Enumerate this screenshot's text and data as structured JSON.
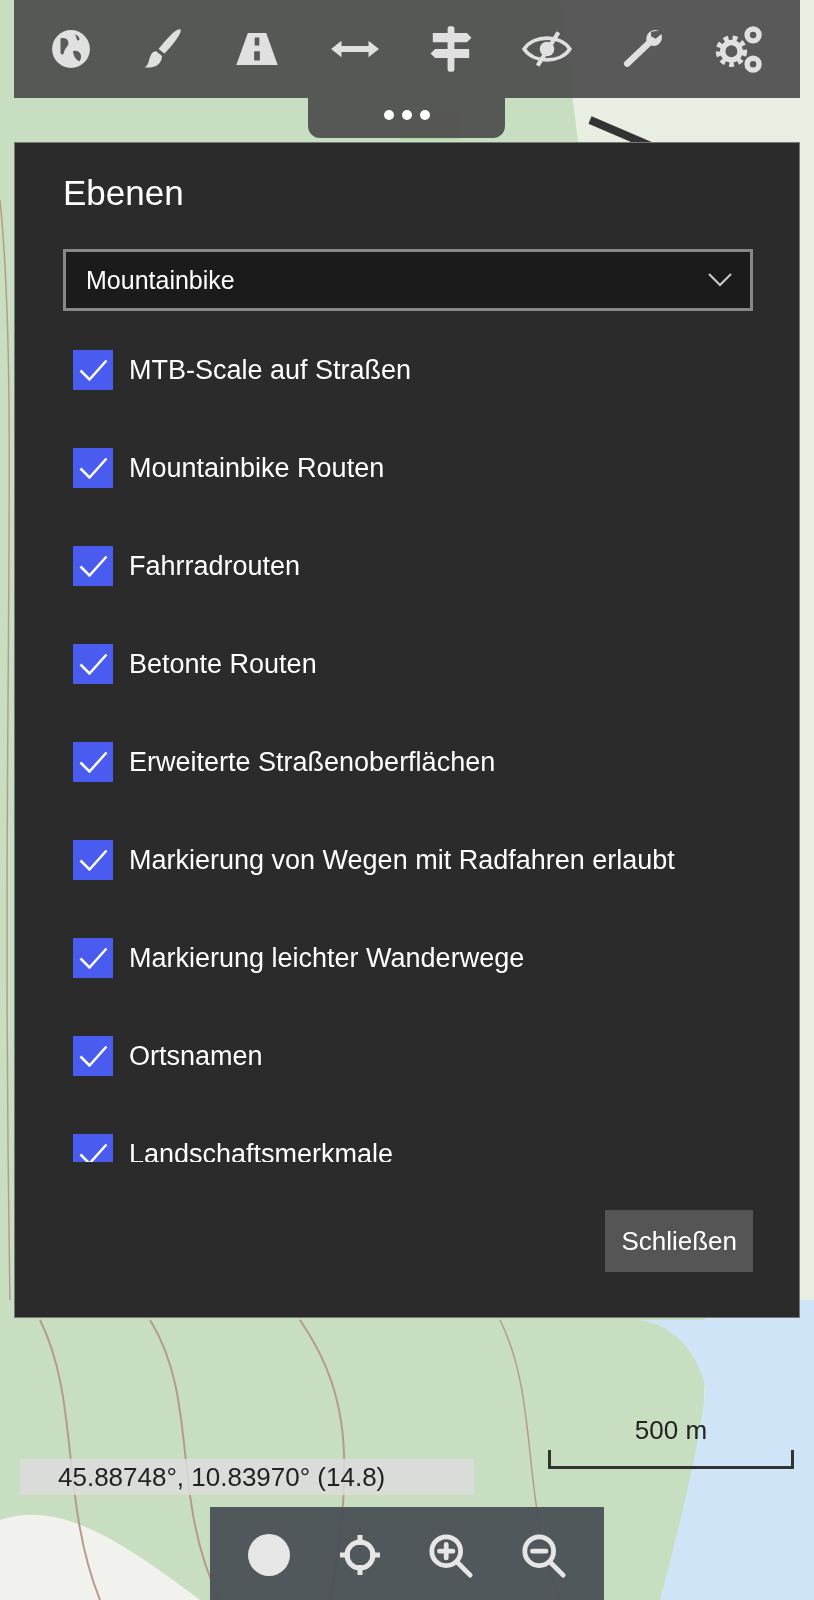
{
  "panel": {
    "title": "Ebenen",
    "preset": {
      "value": "Mountainbike"
    },
    "layers": [
      {
        "label": "MTB-Scale auf Straßen",
        "checked": true
      },
      {
        "label": "Mountainbike Routen",
        "checked": true
      },
      {
        "label": "Fahrradrouten",
        "checked": true
      },
      {
        "label": "Betonte Routen",
        "checked": true
      },
      {
        "label": "Erweiterte Straßenoberflächen",
        "checked": true
      },
      {
        "label": "Markierung von Wegen mit Radfahren erlaubt",
        "checked": true
      },
      {
        "label": "Markierung leichter Wanderwege",
        "checked": true
      },
      {
        "label": "Ortsnamen",
        "checked": true
      },
      {
        "label": "Landschaftsmerkmale",
        "checked": true
      }
    ],
    "close_button": "Schließen"
  },
  "coordinates": "45.88748°, 10.83970° (14.8)",
  "scale": "500 m"
}
